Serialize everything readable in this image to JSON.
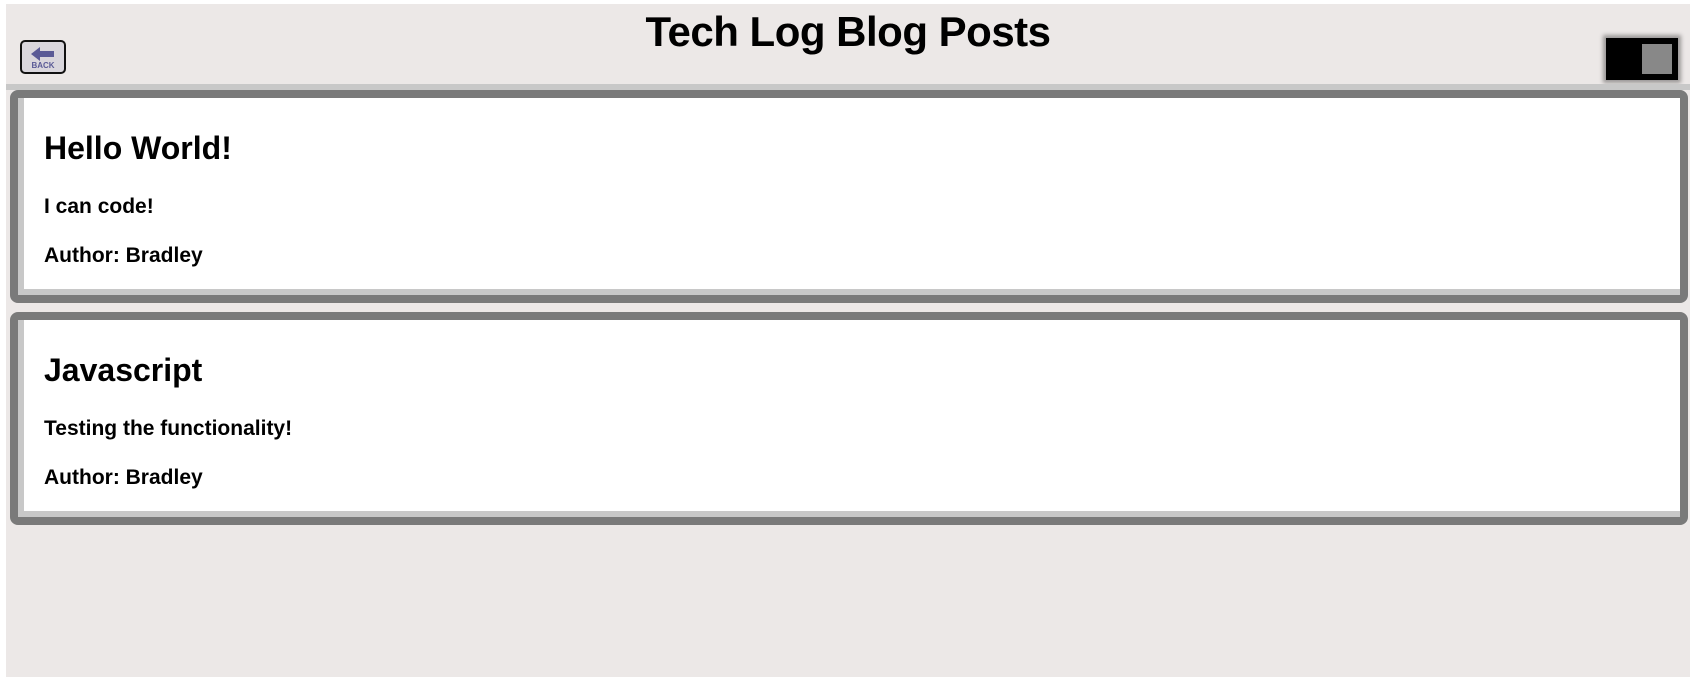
{
  "header": {
    "title": "Tech Log Blog Posts",
    "back_label": "BACK"
  },
  "theme_toggle": {
    "state": "on"
  },
  "posts": [
    {
      "title": "Hello World!",
      "body": "I can code!",
      "author": "Author: Bradley"
    },
    {
      "title": "Javascript",
      "body": "Testing the functionality!",
      "author": "Author: Bradley"
    }
  ],
  "colors": {
    "page_background": "#ece8e7",
    "card_border": "#7a7a7a",
    "back_icon": "#5a5a96"
  },
  "icons": {
    "back": "left-arrow-icon"
  }
}
